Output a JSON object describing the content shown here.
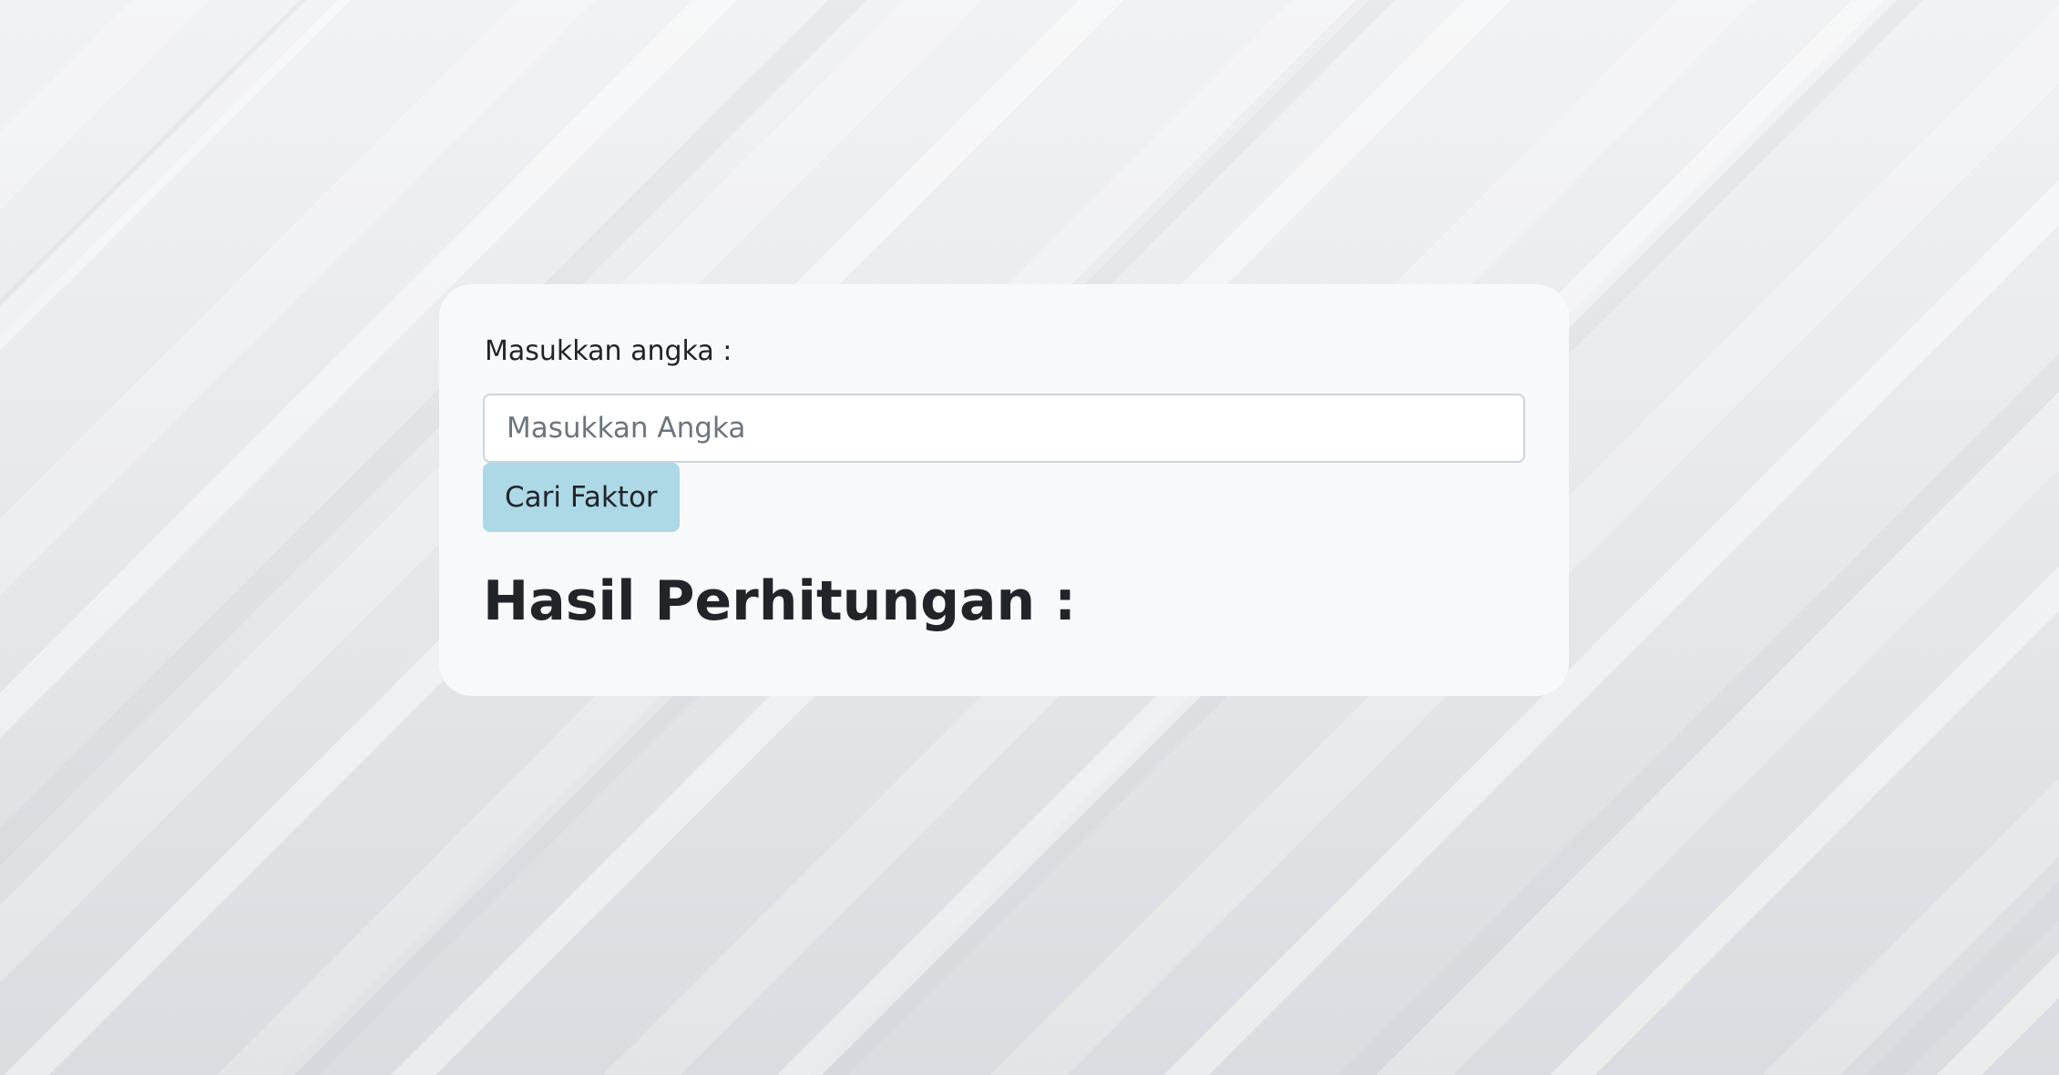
{
  "form": {
    "label": "Masukkan angka :",
    "input_value": "",
    "input_placeholder": "Masukkan Angka",
    "submit_label": "Cari Faktor"
  },
  "result": {
    "title": "Hasil Perhitungan :"
  },
  "colors": {
    "card_background": "#f8f9fa",
    "button_background": "#add8e6",
    "text": "#212529",
    "placeholder": "#6c757d"
  }
}
